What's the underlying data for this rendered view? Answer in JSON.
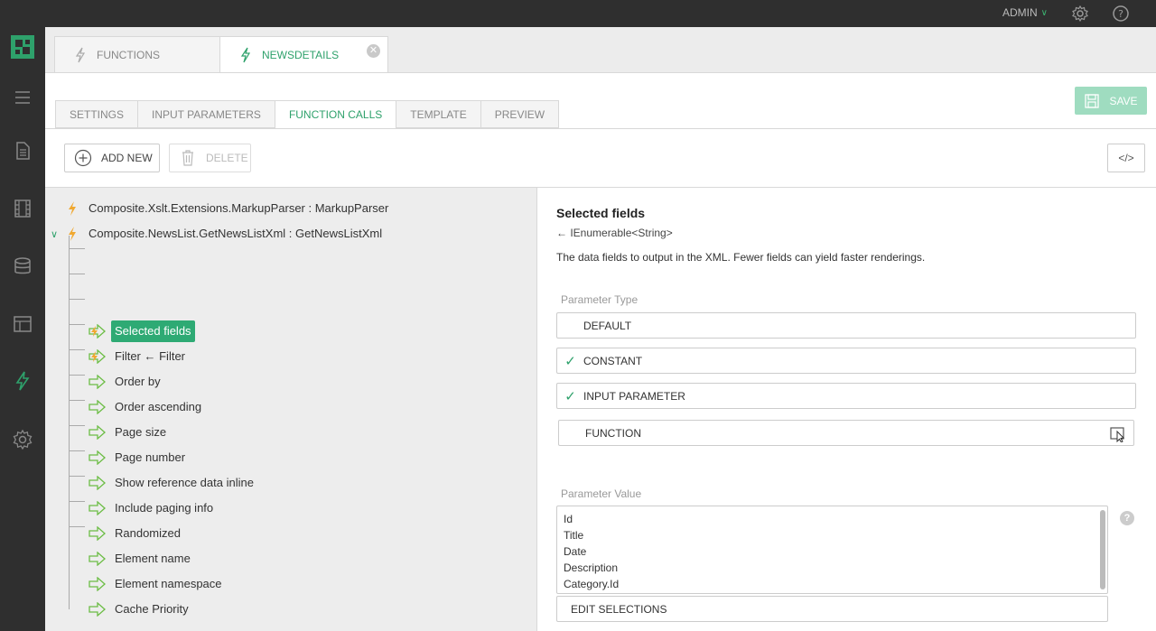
{
  "topbar": {
    "user": "ADMIN"
  },
  "sidebar": {
    "items": [
      {
        "icon": "menu-icon"
      },
      {
        "icon": "page-icon"
      },
      {
        "icon": "media-icon"
      },
      {
        "icon": "database-icon"
      },
      {
        "icon": "layout-icon"
      },
      {
        "icon": "function-icon"
      },
      {
        "icon": "settings-icon"
      }
    ]
  },
  "doc_tabs": [
    {
      "label": "FUNCTIONS",
      "active": false
    },
    {
      "label": "NEWSDETAILS",
      "active": true
    }
  ],
  "sub_tabs": [
    {
      "label": "SETTINGS"
    },
    {
      "label": "INPUT PARAMETERS"
    },
    {
      "label": "FUNCTION CALLS",
      "active": true
    },
    {
      "label": "TEMPLATE"
    },
    {
      "label": "PREVIEW"
    }
  ],
  "toolbar": {
    "save_label": "SAVE",
    "add_new_label": "ADD NEW",
    "delete_label": "DELETE",
    "code_label": "</>"
  },
  "tree": {
    "calls": [
      {
        "label": "Composite.Xslt.Extensions.MarkupParser : MarkupParser"
      },
      {
        "label": "Composite.NewsList.GetNewsListXml : GetNewsListXml"
      }
    ],
    "params": [
      {
        "label": "Selected fields",
        "selected": true,
        "has_value": true
      },
      {
        "label": "Filter ← Filter",
        "has_value": true
      },
      {
        "label": "Order by"
      },
      {
        "label": "Order ascending"
      },
      {
        "label": "Page size"
      },
      {
        "label": "Page number"
      },
      {
        "label": "Show reference data inline"
      },
      {
        "label": "Include paging info"
      },
      {
        "label": "Randomized"
      },
      {
        "label": "Element name"
      },
      {
        "label": "Element namespace"
      },
      {
        "label": "Cache Priority"
      }
    ]
  },
  "details": {
    "title": "Selected fields",
    "type": "← IEnumerable<String>",
    "description": "The data fields to output in the XML. Fewer fields can yield faster renderings.",
    "parameter_type_label": "Parameter Type",
    "options": [
      {
        "label": "DEFAULT",
        "checked": false
      },
      {
        "label": "CONSTANT",
        "checked": true
      },
      {
        "label": "INPUT PARAMETER",
        "checked": true
      },
      {
        "label": "FUNCTION",
        "checked": false
      }
    ],
    "parameter_value_label": "Parameter Value",
    "values": [
      "Id",
      "Title",
      "Date",
      "Description",
      "Category.Id"
    ],
    "edit_selections_label": "EDIT SELECTIONS",
    "help": "?"
  },
  "colors": {
    "accent": "#2ea16b",
    "sidebar": "#2f2f2f",
    "selected": "#2eaa74",
    "function_icon": "#f0a830"
  }
}
